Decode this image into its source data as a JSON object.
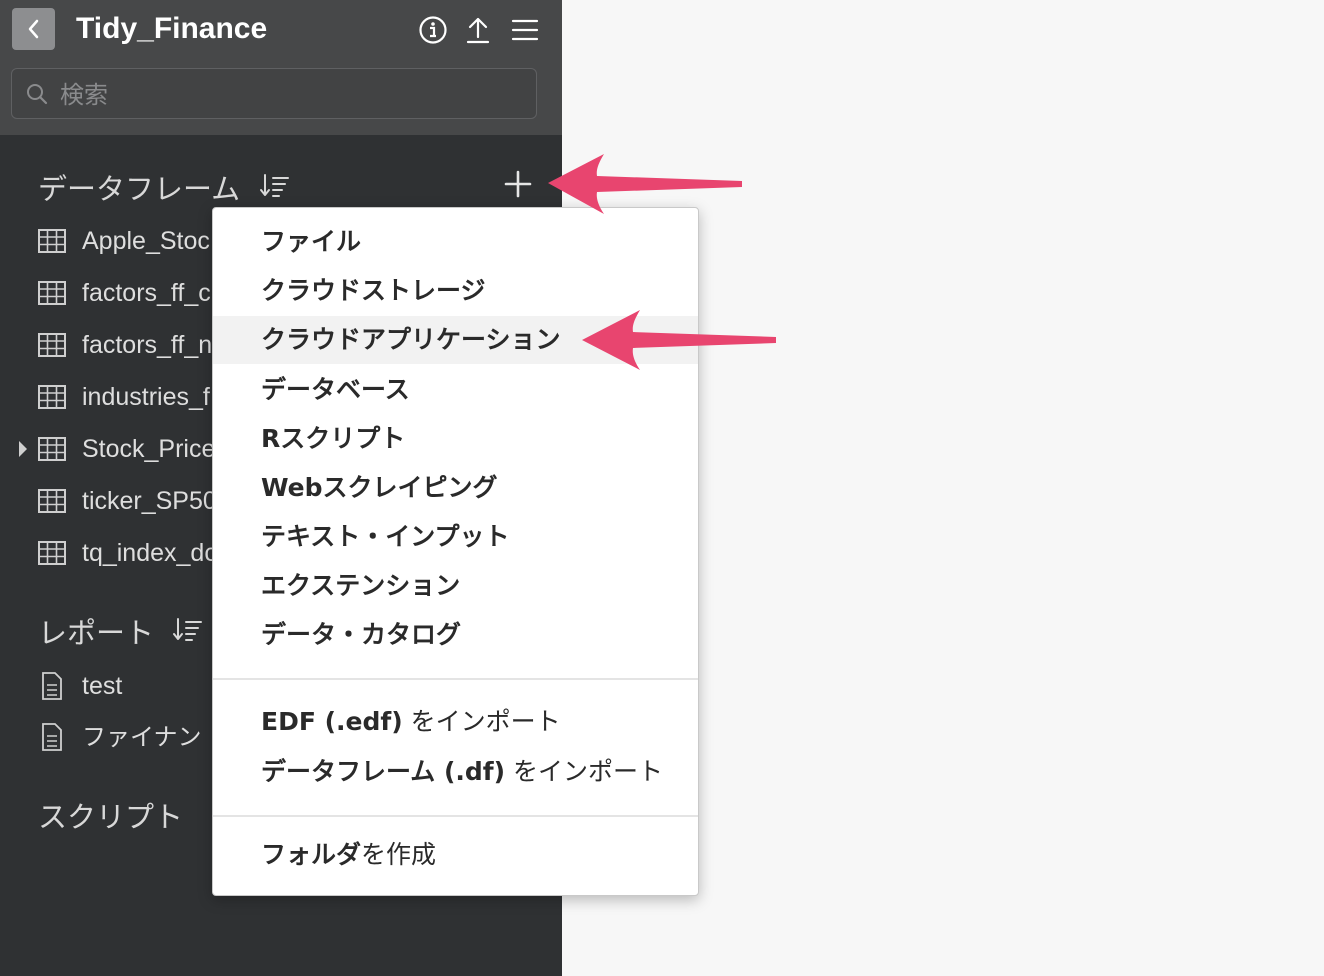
{
  "app": {
    "title": "Tidy_Finance"
  },
  "search": {
    "placeholder": "検索"
  },
  "dataframes": {
    "section_title": "データフレーム",
    "items": [
      {
        "label": "Apple_Stoc",
        "has_children": false
      },
      {
        "label": "factors_ff_c",
        "has_children": false
      },
      {
        "label": "factors_ff_n",
        "has_children": false
      },
      {
        "label": "industries_f",
        "has_children": false
      },
      {
        "label": "Stock_Price",
        "has_children": true
      },
      {
        "label": "ticker_SP50",
        "has_children": false
      },
      {
        "label": "tq_index_dc",
        "has_children": false
      }
    ]
  },
  "reports": {
    "section_title": "レポート",
    "items": [
      {
        "label": "test"
      },
      {
        "label": "ファイナン"
      }
    ]
  },
  "scripts": {
    "section_title": "スクリプト"
  },
  "menu": {
    "items": [
      {
        "label": "ファイル"
      },
      {
        "label": "クラウドストレージ"
      },
      {
        "label": "クラウドアプリケーション",
        "highlighted": true
      },
      {
        "label": "データベース"
      },
      {
        "label": "Rスクリプト"
      },
      {
        "label": "Webスクレイピング"
      },
      {
        "label": "テキスト・インプット"
      },
      {
        "label": "エクステンション"
      },
      {
        "label": "データ・カタログ"
      }
    ],
    "import_items": [
      {
        "bold": "EDF (.edf)",
        "normal": " をインポート"
      },
      {
        "bold": "データフレーム (.df)",
        "normal": " をインポート"
      }
    ],
    "folder_item": {
      "bold": "フォルダ",
      "normal": "を作成"
    }
  },
  "icons": {
    "back": "chevron-left-icon",
    "info": "info-icon",
    "export": "upload-icon",
    "menu": "hamburger-icon",
    "search": "search-icon",
    "sort": "sort-icon",
    "add": "plus-icon",
    "table": "table-icon",
    "document": "document-icon"
  },
  "colors": {
    "sidebar_bg": "#2f3133",
    "topbar_bg": "#474849",
    "annotation_arrow": "#e8456f",
    "menu_highlight": "#f2f2f2"
  }
}
